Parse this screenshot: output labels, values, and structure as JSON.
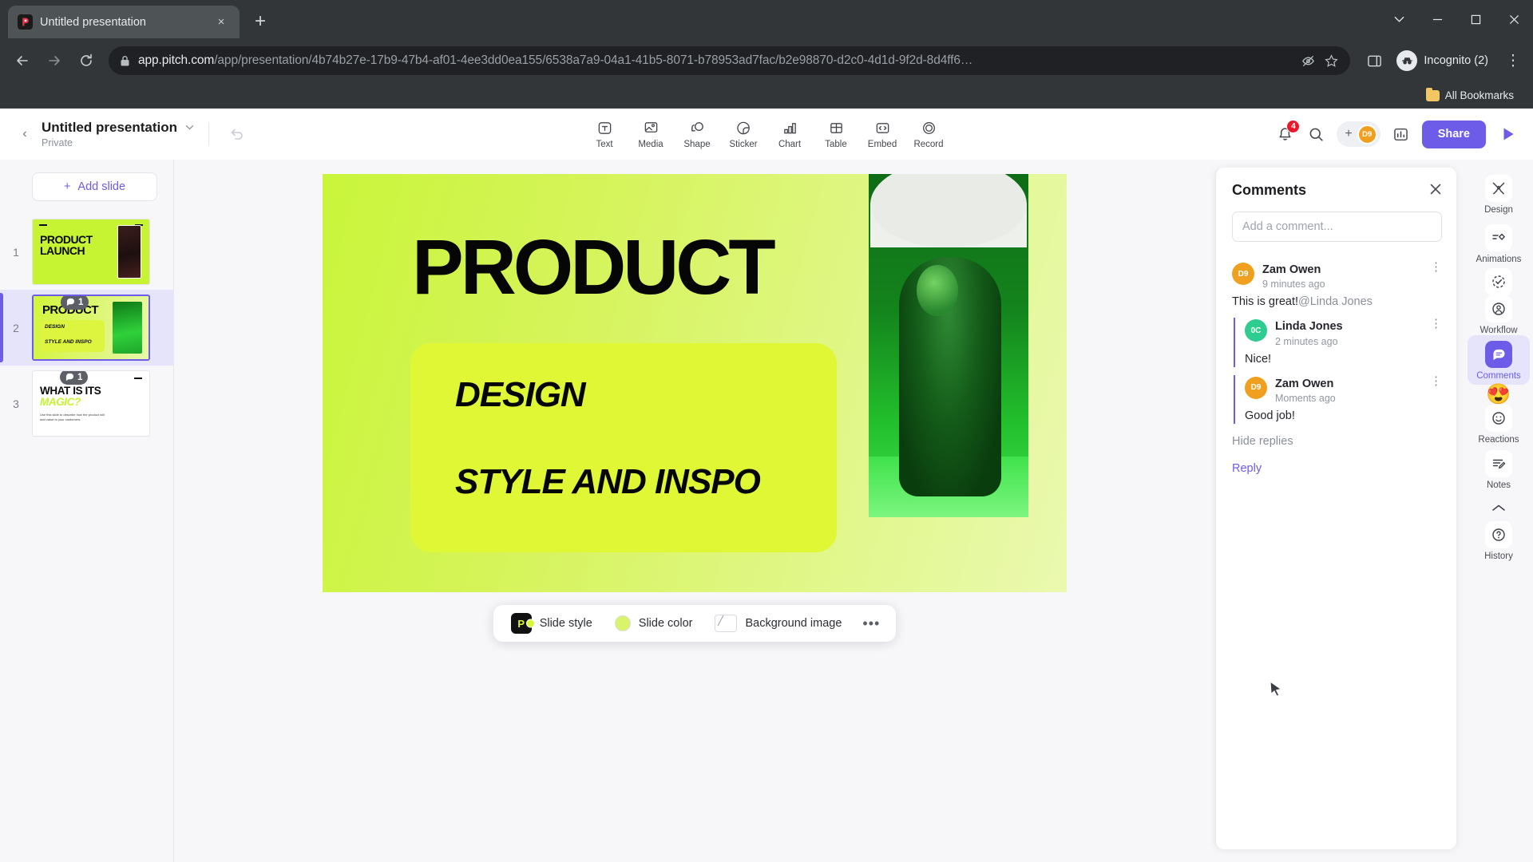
{
  "browser": {
    "tab": {
      "title": "Untitled presentation",
      "favicon": "pitch-logo-icon",
      "close": "×"
    },
    "newtab_label": "+",
    "window_controls": [
      "chevron-down",
      "minimize",
      "maximize",
      "close"
    ],
    "nav": {
      "back": "←",
      "forward": "→",
      "reload": "↻"
    },
    "url": {
      "domain": "app.pitch.com",
      "path": "/app/presentation/4b74b27e-17b9-47b4-af01-4ee3dd0ea155/6538a7a9-04a1-41b5-8071-b78953ad7fac/b2e98870-d2c0-4d1d-9f2d-8d4ff6…",
      "lock": "lock-icon"
    },
    "profile_label": "Incognito (2)",
    "bookmarks": {
      "all_label": "All Bookmarks"
    }
  },
  "app": {
    "header": {
      "back": "‹",
      "title": "Untitled presentation",
      "subtitle": "Private",
      "caret": "⌄",
      "undo": "undo-icon"
    },
    "insert_tools": [
      {
        "label": "Text",
        "icon": "text-icon"
      },
      {
        "label": "Media",
        "icon": "media-icon"
      },
      {
        "label": "Shape",
        "icon": "shape-icon"
      },
      {
        "label": "Sticker",
        "icon": "sticker-icon"
      },
      {
        "label": "Chart",
        "icon": "chart-icon"
      },
      {
        "label": "Table",
        "icon": "table-icon"
      },
      {
        "label": "Embed",
        "icon": "embed-icon"
      },
      {
        "label": "Record",
        "icon": "record-icon"
      }
    ],
    "top_right": {
      "notifications_count": "4",
      "search": "search-icon",
      "add_people": "+",
      "avatar_initials": "D9",
      "analytics": "analytics-icon",
      "share_label": "Share",
      "present": "present-icon"
    }
  },
  "rail": {
    "add_slide_label": "Add slide",
    "add_slide_plus": "+",
    "slides": [
      {
        "number": "1",
        "comments": null,
        "title_line1": "PRODUCT",
        "title_line2": "LAUNCH"
      },
      {
        "number": "2",
        "comments": "1",
        "heading": "PRODUCT",
        "sub1": "DESIGN",
        "sub2": "STYLE AND INSPO"
      },
      {
        "number": "3",
        "comments": "1",
        "title_line1": "WHAT IS ITS",
        "title_line2": "MAGIC?",
        "body": "Use this slide to describe how the product will add value to your customers."
      }
    ]
  },
  "slide": {
    "title": "PRODUCT",
    "sub1": "DESIGN",
    "sub2": "STYLE AND INSPO"
  },
  "slide_toolbar": {
    "style_label": "Slide style",
    "color_label": "Slide color",
    "background_label": "Background image",
    "more": "•••",
    "color_swatch": "#d9f36a"
  },
  "comments": {
    "title": "Comments",
    "close": "×",
    "input_placeholder": "Add a comment...",
    "thread": {
      "author": "Zam Owen",
      "initials": "D9",
      "avatar_color": "#f0a01e",
      "time": "9 minutes ago",
      "text": "This is great!",
      "mention": "@Linda Jones",
      "menu": "⋮",
      "replies": [
        {
          "author": "Linda Jones",
          "initials": "0C",
          "avatar_color": "#2ecc8f",
          "time": "2 minutes ago",
          "text": "Nice!",
          "menu": "⋮"
        },
        {
          "author": "Zam Owen",
          "initials": "D9",
          "avatar_color": "#f0a01e",
          "time": "Moments ago",
          "text": "Good job!",
          "menu": "⋮"
        }
      ],
      "hide_replies_label": "Hide replies",
      "reply_label": "Reply"
    }
  },
  "right_rail": [
    {
      "label": "Design",
      "icon": "design-icon",
      "selected": false
    },
    {
      "label": "Animations",
      "icon": "animations-icon",
      "selected": false
    },
    {
      "label": "Workflow",
      "icon": "workflow-icon",
      "icon2": "person-icon",
      "selected": false
    },
    {
      "label": "Comments",
      "icon": "comment-icon",
      "selected": true
    },
    {
      "label": "Reactions",
      "icon": "smiley-icon",
      "emoji": "😍",
      "selected": false
    },
    {
      "label": "Notes",
      "icon": "notes-icon",
      "selected": false
    },
    {
      "label": "History",
      "icon": "help-icon",
      "chevron": "⌃",
      "selected": false
    }
  ],
  "colors": {
    "accent": "#6c5ce7",
    "slide_bg": "#c9f53a",
    "badge_red": "#e8192c"
  }
}
